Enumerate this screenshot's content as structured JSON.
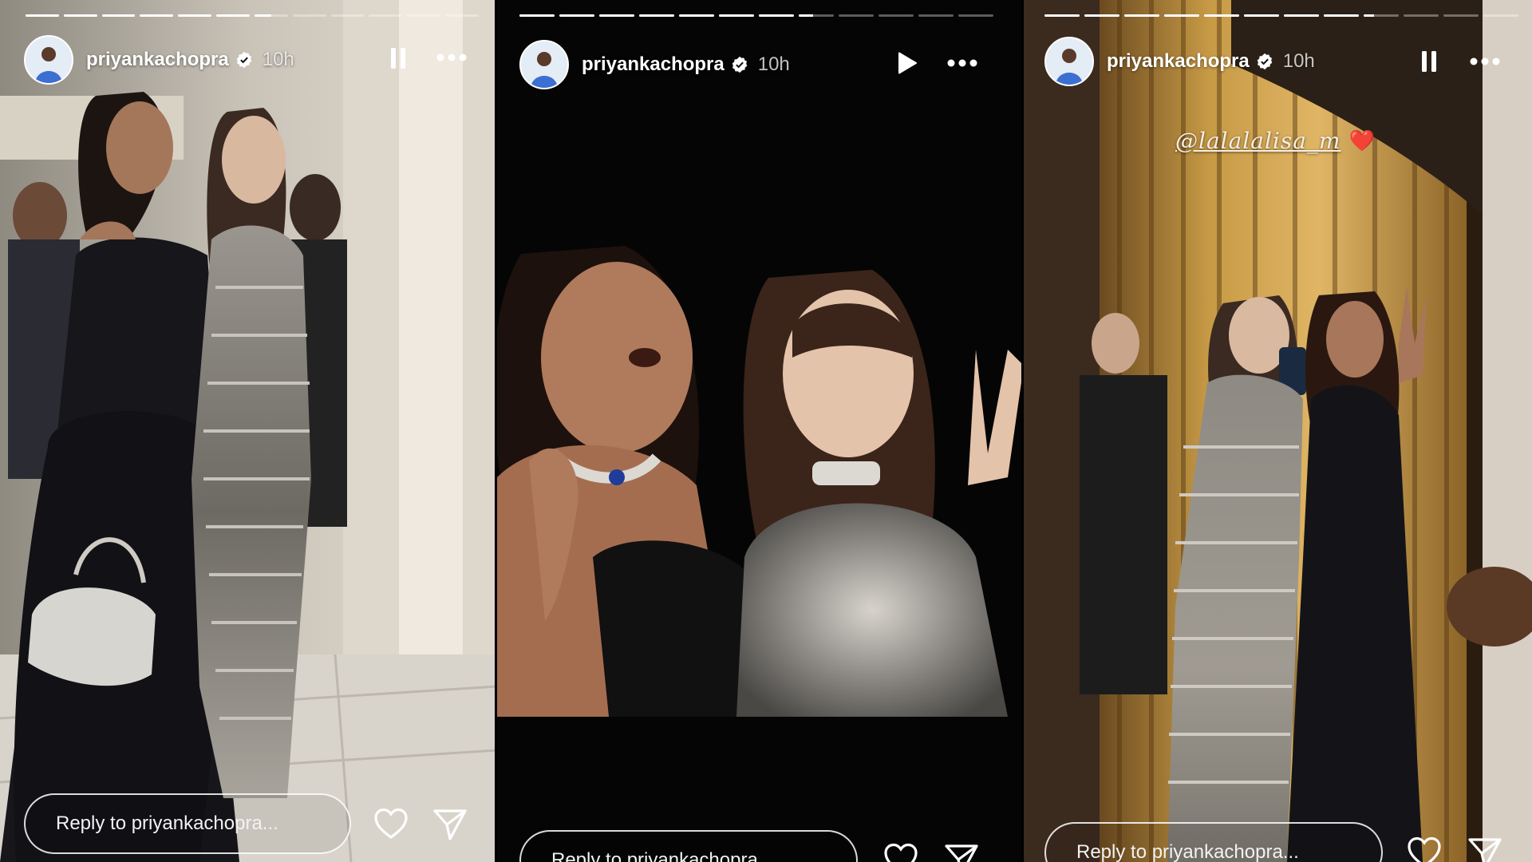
{
  "stories": [
    {
      "username": "priyankachopra",
      "time": "10h",
      "playback_state": "pause",
      "progress": {
        "segments": 12,
        "completed": 6,
        "current_fraction": 0.5
      },
      "reply_placeholder": "Reply to priyankachopra..."
    },
    {
      "username": "priyankachopra",
      "time": "10h",
      "playback_state": "play",
      "progress": {
        "segments": 12,
        "completed": 7,
        "current_fraction": 0.4
      },
      "reply_placeholder": "Reply to priyankachopra..."
    },
    {
      "username": "priyankachopra",
      "time": "10h",
      "playback_state": "pause",
      "progress": {
        "segments": 12,
        "completed": 8,
        "current_fraction": 0.3
      },
      "reply_placeholder": "Reply to priyankachopra...",
      "mention": "@lalalalisa_m",
      "mention_emoji": "❤️"
    }
  ],
  "icons": [
    "verified-badge-icon",
    "pause-icon",
    "play-icon",
    "more-options-icon",
    "heart-icon",
    "send-icon"
  ],
  "colors": {
    "background": "#000000",
    "text": "#ffffff",
    "verified": "#ffffff"
  }
}
